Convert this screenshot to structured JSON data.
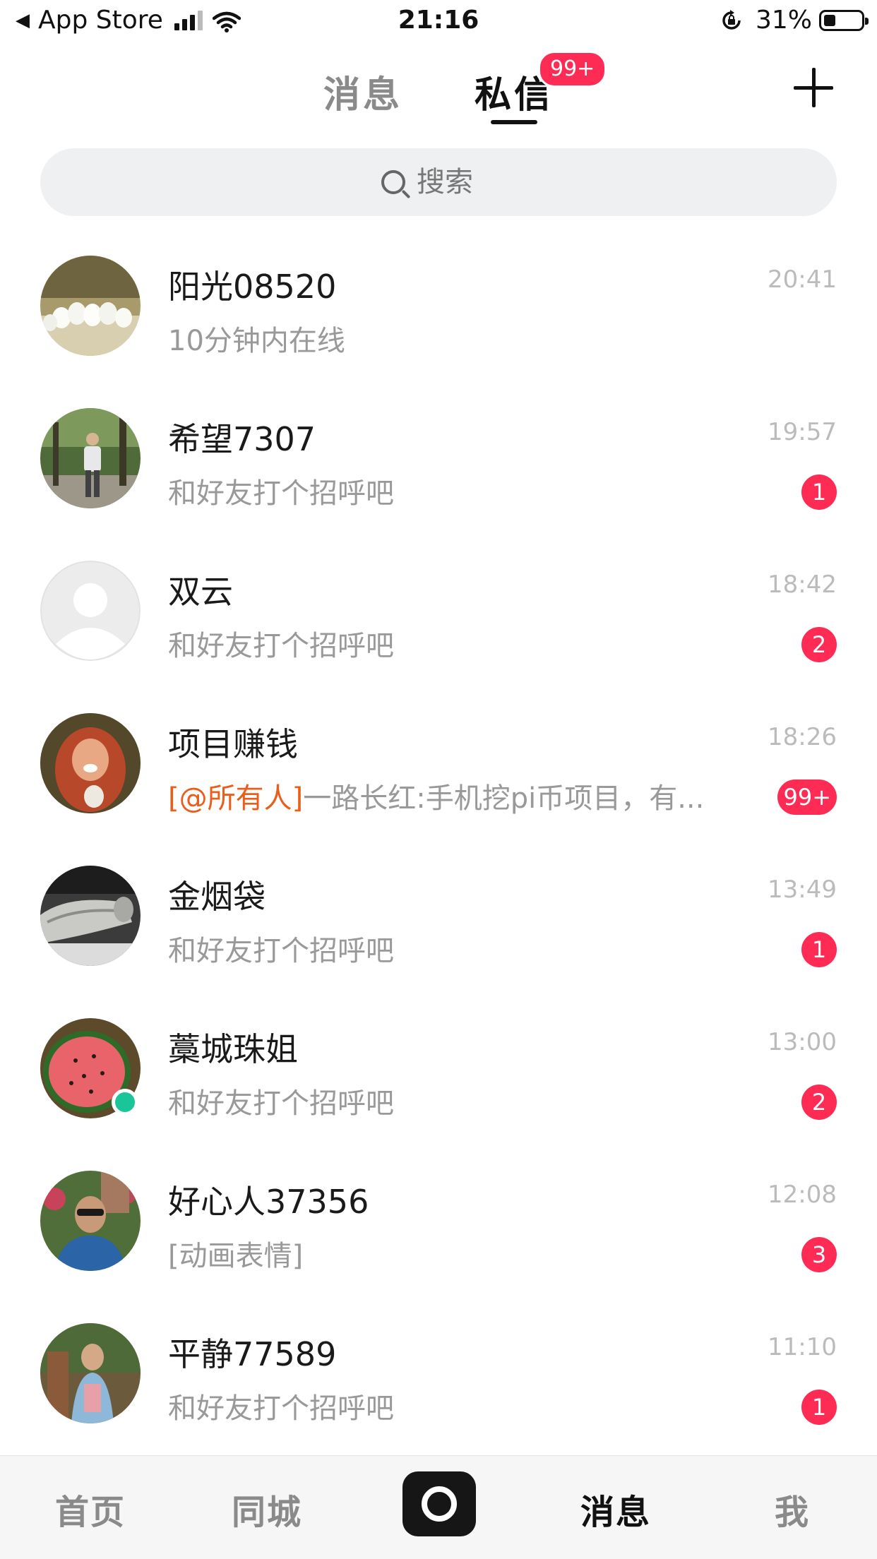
{
  "status_bar": {
    "back_app": "App Store",
    "time": "21:16",
    "battery": "31%",
    "battery_level": 0.31
  },
  "header": {
    "tab_messages": "消息",
    "tab_private": "私信",
    "private_badge": "99+"
  },
  "search": {
    "placeholder": "搜索"
  },
  "conversations": [
    {
      "name": "阳光08520",
      "preview": "10分钟内在线",
      "time": "20:41",
      "badge": ""
    },
    {
      "name": "希望7307",
      "preview": "和好友打个招呼吧",
      "time": "19:57",
      "badge": "1"
    },
    {
      "name": "双云",
      "preview": "和好友打个招呼吧",
      "time": "18:42",
      "badge": "2"
    },
    {
      "name": "项目赚钱",
      "mention": "[@所有人]",
      "preview": "一路长红:手机挖pi币项目，有...",
      "time": "18:26",
      "badge": "99+"
    },
    {
      "name": "金烟袋",
      "preview": "和好友打个招呼吧",
      "time": "13:49",
      "badge": "1"
    },
    {
      "name": "藁城珠姐",
      "preview": "和好友打个招呼吧",
      "time": "13:00",
      "badge": "2"
    },
    {
      "name": "好心人37356",
      "preview": "[动画表情]",
      "time": "12:08",
      "badge": "3"
    },
    {
      "name": "平静77589",
      "preview": "和好友打个招呼吧",
      "time": "11:10",
      "badge": "1"
    }
  ],
  "bottom_nav": {
    "home": "首页",
    "city": "同城",
    "messages": "消息",
    "me": "我"
  },
  "colors": {
    "accent_red": "#fe2c55",
    "online_green": "#1ac59a",
    "mention_orange": "#ea5d1b"
  }
}
